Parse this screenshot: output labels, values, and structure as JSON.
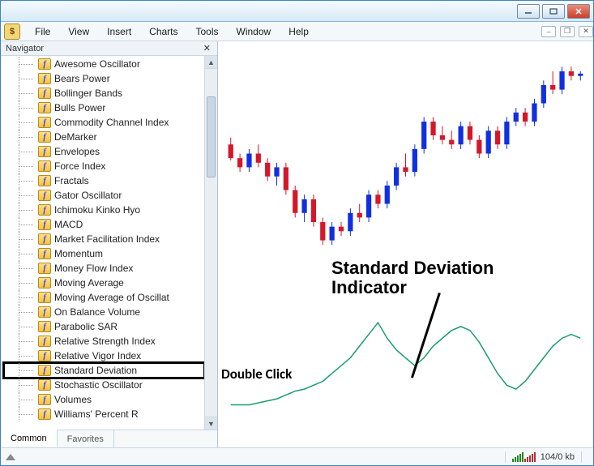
{
  "menu": {
    "items": [
      "File",
      "View",
      "Insert",
      "Charts",
      "Tools",
      "Window",
      "Help"
    ]
  },
  "navigator": {
    "title": "Navigator",
    "items": [
      "Awesome Oscillator",
      "Bears Power",
      "Bollinger Bands",
      "Bulls Power",
      "Commodity Channel Index",
      "DeMarker",
      "Envelopes",
      "Force Index",
      "Fractals",
      "Gator Oscillator",
      "Ichimoku Kinko Hyo",
      "MACD",
      "Market Facilitation Index",
      "Momentum",
      "Money Flow Index",
      "Moving Average",
      "Moving Average of Oscillat",
      "On Balance Volume",
      "Parabolic SAR",
      "Relative Strength Index",
      "Relative Vigor Index",
      "Standard Deviation",
      "Stochastic Oscillator",
      "Volumes",
      "Williams' Percent R"
    ],
    "highlighted_index": 21,
    "tabs": {
      "active": "Common",
      "inactive": "Favorites"
    }
  },
  "annotations": {
    "main_line1": "Standard Deviation",
    "main_line2": "Indicator",
    "double_click": "Double Click"
  },
  "status": {
    "kb": "104/0 kb"
  },
  "fx_glyph": "f",
  "chart_data": {
    "type": "candlestick_with_indicator",
    "note": "No axes/ticks visible; y positions estimated in 0-100 relative scale",
    "candles": [
      {
        "i": 0,
        "o": 62,
        "h": 65,
        "l": 55,
        "c": 56,
        "color": "red"
      },
      {
        "i": 1,
        "o": 56,
        "h": 58,
        "l": 50,
        "c": 52,
        "color": "red"
      },
      {
        "i": 2,
        "o": 52,
        "h": 60,
        "l": 50,
        "c": 58,
        "color": "blue"
      },
      {
        "i": 3,
        "o": 58,
        "h": 62,
        "l": 52,
        "c": 54,
        "color": "red"
      },
      {
        "i": 4,
        "o": 54,
        "h": 56,
        "l": 46,
        "c": 48,
        "color": "red"
      },
      {
        "i": 5,
        "o": 48,
        "h": 54,
        "l": 44,
        "c": 52,
        "color": "blue"
      },
      {
        "i": 6,
        "o": 52,
        "h": 54,
        "l": 40,
        "c": 42,
        "color": "red"
      },
      {
        "i": 7,
        "o": 42,
        "h": 44,
        "l": 30,
        "c": 32,
        "color": "red"
      },
      {
        "i": 8,
        "o": 32,
        "h": 40,
        "l": 28,
        "c": 38,
        "color": "blue"
      },
      {
        "i": 9,
        "o": 38,
        "h": 40,
        "l": 26,
        "c": 28,
        "color": "red"
      },
      {
        "i": 10,
        "o": 28,
        "h": 30,
        "l": 18,
        "c": 20,
        "color": "red"
      },
      {
        "i": 11,
        "o": 20,
        "h": 28,
        "l": 18,
        "c": 26,
        "color": "blue"
      },
      {
        "i": 12,
        "o": 26,
        "h": 28,
        "l": 22,
        "c": 24,
        "color": "red"
      },
      {
        "i": 13,
        "o": 24,
        "h": 34,
        "l": 22,
        "c": 32,
        "color": "blue"
      },
      {
        "i": 14,
        "o": 32,
        "h": 36,
        "l": 28,
        "c": 30,
        "color": "red"
      },
      {
        "i": 15,
        "o": 30,
        "h": 42,
        "l": 28,
        "c": 40,
        "color": "blue"
      },
      {
        "i": 16,
        "o": 40,
        "h": 42,
        "l": 34,
        "c": 36,
        "color": "red"
      },
      {
        "i": 17,
        "o": 36,
        "h": 46,
        "l": 34,
        "c": 44,
        "color": "blue"
      },
      {
        "i": 18,
        "o": 44,
        "h": 54,
        "l": 42,
        "c": 52,
        "color": "blue"
      },
      {
        "i": 19,
        "o": 52,
        "h": 58,
        "l": 48,
        "c": 50,
        "color": "red"
      },
      {
        "i": 20,
        "o": 50,
        "h": 62,
        "l": 48,
        "c": 60,
        "color": "blue"
      },
      {
        "i": 21,
        "o": 60,
        "h": 74,
        "l": 58,
        "c": 72,
        "color": "blue"
      },
      {
        "i": 22,
        "o": 72,
        "h": 74,
        "l": 64,
        "c": 66,
        "color": "red"
      },
      {
        "i": 23,
        "o": 66,
        "h": 70,
        "l": 62,
        "c": 64,
        "color": "red"
      },
      {
        "i": 24,
        "o": 64,
        "h": 68,
        "l": 60,
        "c": 62,
        "color": "red"
      },
      {
        "i": 25,
        "o": 62,
        "h": 72,
        "l": 60,
        "c": 70,
        "color": "blue"
      },
      {
        "i": 26,
        "o": 70,
        "h": 72,
        "l": 62,
        "c": 64,
        "color": "red"
      },
      {
        "i": 27,
        "o": 64,
        "h": 66,
        "l": 56,
        "c": 58,
        "color": "red"
      },
      {
        "i": 28,
        "o": 58,
        "h": 70,
        "l": 56,
        "c": 68,
        "color": "blue"
      },
      {
        "i": 29,
        "o": 68,
        "h": 70,
        "l": 60,
        "c": 62,
        "color": "red"
      },
      {
        "i": 30,
        "o": 62,
        "h": 74,
        "l": 60,
        "c": 72,
        "color": "blue"
      },
      {
        "i": 31,
        "o": 72,
        "h": 78,
        "l": 70,
        "c": 76,
        "color": "blue"
      },
      {
        "i": 32,
        "o": 76,
        "h": 78,
        "l": 70,
        "c": 72,
        "color": "red"
      },
      {
        "i": 33,
        "o": 72,
        "h": 82,
        "l": 70,
        "c": 80,
        "color": "blue"
      },
      {
        "i": 34,
        "o": 80,
        "h": 90,
        "l": 78,
        "c": 88,
        "color": "blue"
      },
      {
        "i": 35,
        "o": 88,
        "h": 94,
        "l": 84,
        "c": 86,
        "color": "red"
      },
      {
        "i": 36,
        "o": 86,
        "h": 96,
        "l": 84,
        "c": 94,
        "color": "blue"
      },
      {
        "i": 37,
        "o": 94,
        "h": 96,
        "l": 90,
        "c": 92,
        "color": "red"
      },
      {
        "i": 38,
        "o": 92,
        "h": 94,
        "l": 90,
        "c": 93,
        "color": "blue"
      }
    ],
    "indicator": {
      "name": "Standard Deviation",
      "color": "#1a9d6d",
      "points": [
        6,
        6,
        6,
        7,
        8,
        9,
        11,
        13,
        14,
        16,
        18,
        22,
        26,
        30,
        36,
        42,
        48,
        40,
        34,
        30,
        26,
        30,
        36,
        40,
        44,
        46,
        44,
        38,
        30,
        22,
        16,
        14,
        18,
        24,
        30,
        36,
        40,
        42,
        40
      ]
    }
  }
}
